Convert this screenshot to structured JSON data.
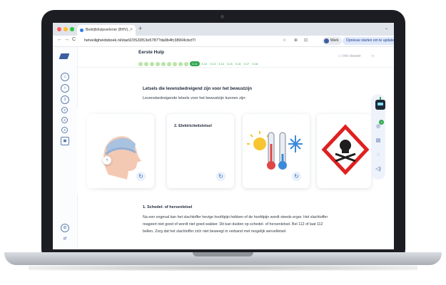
{
  "browser": {
    "tab_title": "Bedrijfshulpverlener (BHV)...",
    "tab_close": "×",
    "new_tab": "+",
    "tab_menu": "⌄",
    "nav_back": "←",
    "nav_forward": "→",
    "nav_reload": "C",
    "url": "hetveiligheidsboek.nl/start2/3S33f13e5787?da9b4fc38904cbcf7/",
    "work_label": "Werk",
    "update_label": "Opnieuw starten om te updaten ⋮"
  },
  "header": {
    "title": "Eerste Hulp",
    "progress_total_done": 9,
    "progress_current": "3.11",
    "progress_next": [
      "3.12",
      "3.13",
      "3.14",
      "3.15",
      "3.16",
      "3.17",
      "3.18"
    ],
    "tool_label": "Info dossier",
    "search_icon": "search-icon"
  },
  "sidebar": {
    "items": [
      "⌂",
      "i",
      "1",
      "2",
      "3",
      "4",
      "▣"
    ],
    "bottom": [
      "⚙",
      "⇄"
    ]
  },
  "content": {
    "title": "Letsels die levensbedreigend zijn voor het bewustzijn",
    "subtitle": "Levensbedreigende letsels voor het bewustzijn kunnen zijn:",
    "cards": [
      {
        "label": "",
        "image": "head-injury"
      },
      {
        "label": "2. Elektriciteitsletsel",
        "image": ""
      },
      {
        "label": "",
        "image": "thermometers-sun-snow"
      },
      {
        "label": "",
        "image": "toxic-hazard"
      }
    ],
    "card_action_icon": "↻",
    "prev_icon": "‹",
    "section_title": "1. Schedel- of hersenletsel",
    "body": "Na een ongeval kan het slachtoffer hevige hoofdpijn hebben of de hoofdpijn wordt steeds erger. Het slachtoffer reageert niet goed of wordt niet goed wakker. Dit kan duiden op schedel- of hersenletsel. Bel 112 of laat 112 bellen. Zorg dat het slachtoffer zich niet beweegt in verband met mogelijk wervelletsel."
  },
  "rail": {
    "badge": "3",
    "icons": [
      "◎",
      "▤",
      "◌",
      "◁)"
    ]
  },
  "colors": {
    "accent": "#3b5fa0",
    "progress_green": "#2fa84f",
    "progress_done": "#b9e5a8"
  }
}
